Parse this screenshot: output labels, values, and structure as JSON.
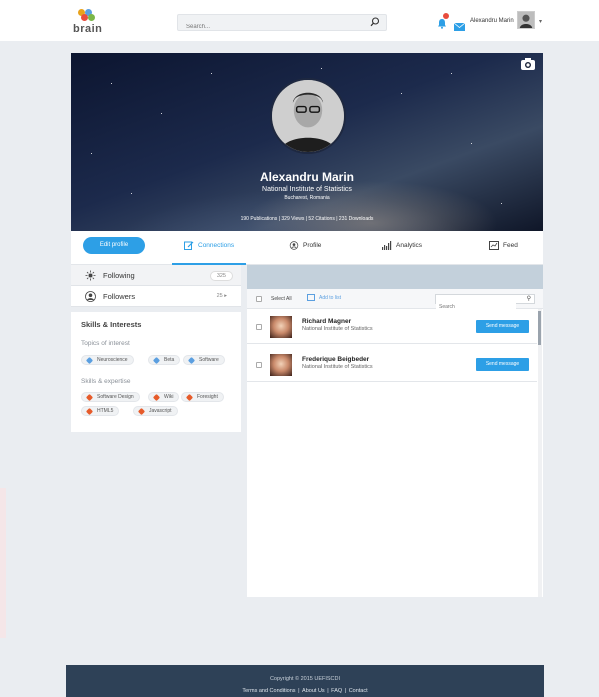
{
  "header": {
    "logo_text": "brain",
    "search_placeholder": "Search...",
    "notification_count": "",
    "user_name": "Alexandru Marin"
  },
  "profile": {
    "name": "Alexandru Marin",
    "institution": "National Institute of Statistics",
    "location": "Bucharest, Romania",
    "stats": "190 Publications | 329 Views | 52 Citations | 231 Downloads"
  },
  "nav": {
    "edit_profile": "Edit profile",
    "tabs": [
      {
        "label": "Connections",
        "icon": "edit-icon"
      },
      {
        "label": "Profile",
        "icon": "user-icon"
      },
      {
        "label": "Analytics",
        "icon": "bar-chart-icon"
      },
      {
        "label": "Feed",
        "icon": "feed-icon"
      }
    ]
  },
  "sidebar": {
    "items": [
      {
        "label": "Following",
        "count": "325",
        "icon": "following-icon"
      },
      {
        "label": "Followers",
        "count": "25 ▸",
        "icon": "followers-icon"
      }
    ]
  },
  "skills": {
    "title": "Skills & Interests",
    "topics_title": "Topics of interest",
    "topics": [
      "Neuroscience",
      "Beta",
      "Software"
    ],
    "expertise_title": "Skills & expertise",
    "expertise": [
      "Software Design",
      "Wiki",
      "Foresight",
      "HTML5",
      "Javascript"
    ]
  },
  "connections": {
    "select_all": "Select All",
    "add_to_list": "Add to list",
    "search_placeholder": "Search",
    "rows": [
      {
        "name": "Richard Magner",
        "org": "National Institute of Statistics",
        "action": "Send message"
      },
      {
        "name": "Frederique Beigbeder",
        "org": "National Institute of Statistics",
        "action": "Send message"
      }
    ]
  },
  "footer": {
    "copyright": "Copyright © 2015 UEFISCDI",
    "links": [
      "Terms and Conditions",
      "About Us",
      "FAQ",
      "Contact"
    ]
  },
  "colors": {
    "accent": "#2d9fe6",
    "footer_bg": "#2e4157",
    "panel_header": "#c3d0db"
  }
}
